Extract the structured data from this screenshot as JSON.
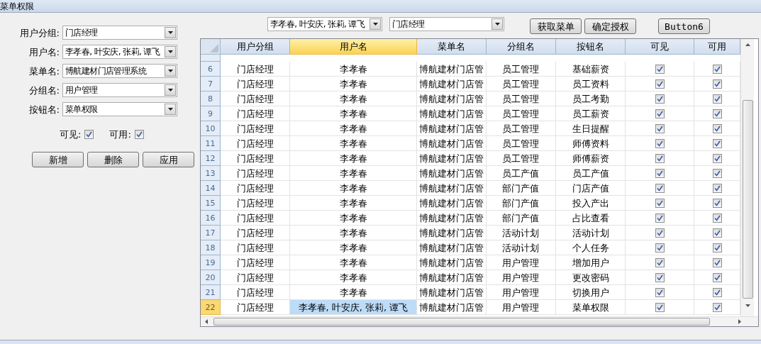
{
  "window": {
    "title": "菜单权限"
  },
  "form": {
    "fields": [
      {
        "label": "用户分组:",
        "value": "门店经理"
      },
      {
        "label": "用户名:",
        "value": "李孝春, 叶安庆, 张莉, 谭飞"
      },
      {
        "label": "菜单名:",
        "value": "博航建材门店管理系统"
      },
      {
        "label": "分组名:",
        "value": "用户管理"
      },
      {
        "label": "按钮名:",
        "value": "菜单权限"
      }
    ],
    "checks": [
      {
        "label": "可见:",
        "checked": true
      },
      {
        "label": "可用:",
        "checked": true
      }
    ],
    "buttons": [
      "新增",
      "删除",
      "应用"
    ]
  },
  "toolbar": {
    "combos": [
      {
        "value": "李孝春, 叶安庆, 张莉, 谭飞"
      },
      {
        "value": "门店经理"
      }
    ],
    "buttons": [
      "获取菜单",
      "确定授权",
      "Button6"
    ]
  },
  "table": {
    "columns": [
      {
        "label": "用户分组",
        "selected": false
      },
      {
        "label": "用户名",
        "selected": true
      },
      {
        "label": "菜单名",
        "selected": false
      },
      {
        "label": "分组名",
        "selected": false
      },
      {
        "label": "按钮名",
        "selected": false
      },
      {
        "label": "可见",
        "selected": false
      },
      {
        "label": "可用",
        "selected": false
      }
    ],
    "rows": [
      {
        "num": "6",
        "group": "门店经理",
        "user": "李孝春",
        "menu": "博航建材门店管",
        "section": "员工管理",
        "button": "基础薪资",
        "visible": true,
        "enabled": true,
        "selected": false
      },
      {
        "num": "7",
        "group": "门店经理",
        "user": "李孝春",
        "menu": "博航建材门店管",
        "section": "员工管理",
        "button": "员工资料",
        "visible": true,
        "enabled": true,
        "selected": false
      },
      {
        "num": "8",
        "group": "门店经理",
        "user": "李孝春",
        "menu": "博航建材门店管",
        "section": "员工管理",
        "button": "员工考勤",
        "visible": true,
        "enabled": true,
        "selected": false
      },
      {
        "num": "9",
        "group": "门店经理",
        "user": "李孝春",
        "menu": "博航建材门店管",
        "section": "员工管理",
        "button": "员工薪资",
        "visible": true,
        "enabled": true,
        "selected": false
      },
      {
        "num": "10",
        "group": "门店经理",
        "user": "李孝春",
        "menu": "博航建材门店管",
        "section": "员工管理",
        "button": "生日提醒",
        "visible": true,
        "enabled": true,
        "selected": false
      },
      {
        "num": "11",
        "group": "门店经理",
        "user": "李孝春",
        "menu": "博航建材门店管",
        "section": "员工管理",
        "button": "师傅资料",
        "visible": true,
        "enabled": true,
        "selected": false
      },
      {
        "num": "12",
        "group": "门店经理",
        "user": "李孝春",
        "menu": "博航建材门店管",
        "section": "员工管理",
        "button": "师傅薪资",
        "visible": true,
        "enabled": true,
        "selected": false
      },
      {
        "num": "13",
        "group": "门店经理",
        "user": "李孝春",
        "menu": "博航建材门店管",
        "section": "员工产值",
        "button": "员工产值",
        "visible": true,
        "enabled": true,
        "selected": false
      },
      {
        "num": "14",
        "group": "门店经理",
        "user": "李孝春",
        "menu": "博航建材门店管",
        "section": "部门产值",
        "button": "门店产值",
        "visible": true,
        "enabled": true,
        "selected": false
      },
      {
        "num": "15",
        "group": "门店经理",
        "user": "李孝春",
        "menu": "博航建材门店管",
        "section": "部门产值",
        "button": "投入产出",
        "visible": true,
        "enabled": true,
        "selected": false
      },
      {
        "num": "16",
        "group": "门店经理",
        "user": "李孝春",
        "menu": "博航建材门店管",
        "section": "部门产值",
        "button": "占比查看",
        "visible": true,
        "enabled": true,
        "selected": false
      },
      {
        "num": "17",
        "group": "门店经理",
        "user": "李孝春",
        "menu": "博航建材门店管",
        "section": "活动计划",
        "button": "活动计划",
        "visible": true,
        "enabled": true,
        "selected": false
      },
      {
        "num": "18",
        "group": "门店经理",
        "user": "李孝春",
        "menu": "博航建材门店管",
        "section": "活动计划",
        "button": "个人任务",
        "visible": true,
        "enabled": true,
        "selected": false
      },
      {
        "num": "19",
        "group": "门店经理",
        "user": "李孝春",
        "menu": "博航建材门店管",
        "section": "用户管理",
        "button": "增加用户",
        "visible": true,
        "enabled": true,
        "selected": false
      },
      {
        "num": "20",
        "group": "门店经理",
        "user": "李孝春",
        "menu": "博航建材门店管",
        "section": "用户管理",
        "button": "更改密码",
        "visible": true,
        "enabled": true,
        "selected": false
      },
      {
        "num": "21",
        "group": "门店经理",
        "user": "李孝春",
        "menu": "博航建材门店管",
        "section": "用户管理",
        "button": "切换用户",
        "visible": true,
        "enabled": true,
        "selected": false
      },
      {
        "num": "22",
        "group": "门店经理",
        "user": "李孝春, 叶安庆, 张莉, 谭飞",
        "menu": "博航建材门店管",
        "section": "用户管理",
        "button": "菜单权限",
        "visible": true,
        "enabled": true,
        "selected": true
      }
    ]
  }
}
